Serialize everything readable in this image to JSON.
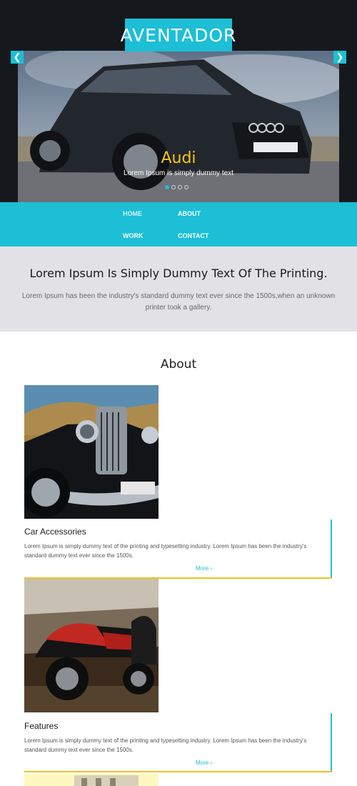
{
  "brand": "AVENTADOR",
  "slider": {
    "title": "Audi",
    "subtitle": "Lorem Ipsum is simply dummy text",
    "prev_icon": "chevron-left-icon",
    "next_icon": "chevron-right-icon"
  },
  "nav": [
    "HOME",
    "ABOUT",
    "WORK",
    "CONTACT"
  ],
  "banner": {
    "heading": "Lorem Ipsum Is Simply Dummy Text Of The Printing.",
    "text": "Lorem Ipsum has been the industry's standard dummy text ever since the 1500s,when an unknown printer took a gallery."
  },
  "about": {
    "title": "About",
    "cards": [
      {
        "title": "Car Accessories",
        "text": "Lorem Ipsum is simply dummy text of the printing and typesetting industry. Lorem Ipsum has been the industry's standard dummy text ever since the 1500s.",
        "more": "More"
      },
      {
        "title": "Features",
        "text": "Lorem Ipsum is simply dummy text of the printing and typesetting industry. Lorem Ipsum has been the industry's standard dummy text ever since the 1500s.",
        "more": "More"
      }
    ]
  },
  "colors": {
    "accent": "#1cbfd6",
    "highlight": "#f2c21b",
    "dark": "#15191d",
    "banner_bg": "#e1e1e6"
  }
}
